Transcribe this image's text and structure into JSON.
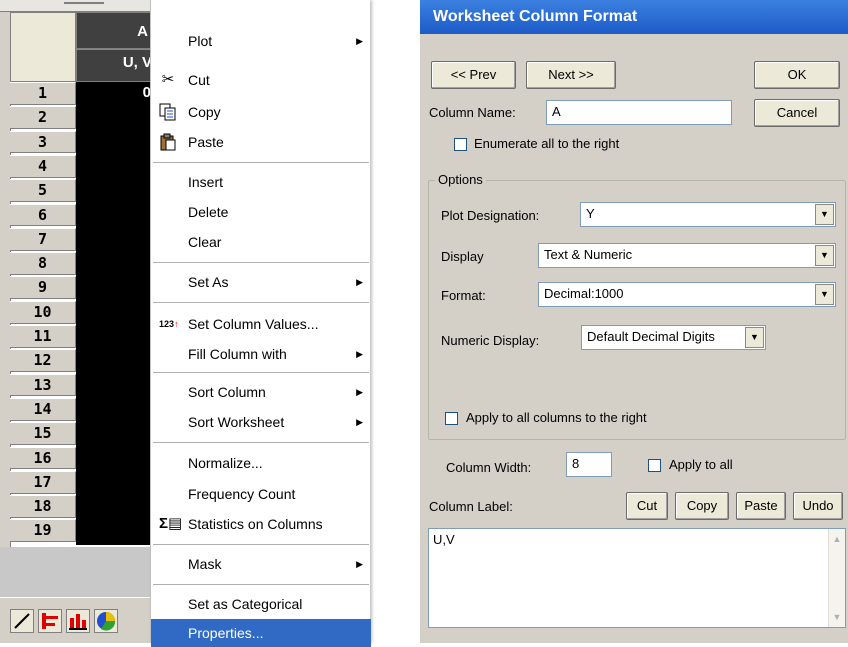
{
  "worksheet": {
    "column_header": "A",
    "column_label": "U, V",
    "row_numbers": [
      "1",
      "2",
      "3",
      "4",
      "5",
      "6",
      "7",
      "8",
      "9",
      "10",
      "11",
      "12",
      "13",
      "14",
      "15",
      "16",
      "17",
      "18",
      "19"
    ],
    "first_cell_value": "0"
  },
  "context_menu": {
    "items": [
      {
        "label": "Plot",
        "submenu": true
      },
      {
        "label": "Cut",
        "icon": "scissors-icon"
      },
      {
        "label": "Copy",
        "icon": "copy-icon"
      },
      {
        "label": "Paste",
        "icon": "paste-icon"
      },
      {
        "label": "Insert"
      },
      {
        "label": "Delete"
      },
      {
        "label": "Clear"
      },
      {
        "label": "Set As",
        "submenu": true
      },
      {
        "label": "Set Column Values...",
        "icon": "set-values-icon"
      },
      {
        "label": "Fill Column with",
        "submenu": true
      },
      {
        "label": "Sort Column",
        "submenu": true
      },
      {
        "label": "Sort Worksheet",
        "submenu": true
      },
      {
        "label": "Normalize..."
      },
      {
        "label": "Frequency Count"
      },
      {
        "label": "Statistics on Columns",
        "icon": "statistics-icon"
      },
      {
        "label": "Mask",
        "submenu": true
      },
      {
        "label": "Set as Categorical"
      },
      {
        "label": "Properties..."
      }
    ],
    "selected_item": "Properties...",
    "highlight_color": "#316ac5"
  },
  "dialog": {
    "title": "Worksheet Column Format",
    "prev_label": "<< Prev",
    "next_label": "Next >>",
    "ok_label": "OK",
    "cancel_label": "Cancel",
    "column_name_label": "Column Name:",
    "column_name_value": "A",
    "enumerate_label": "Enumerate all to the right",
    "options_group": "Options",
    "plot_designation_label": "Plot Designation:",
    "plot_designation_value": "Y",
    "display_label": "Display",
    "display_value": "Text & Numeric",
    "format_label": "Format:",
    "format_value": "Decimal:1000",
    "numeric_display_label": "Numeric Display:",
    "numeric_display_value": "Default Decimal Digits",
    "apply_all_right_label": "Apply to all columns to the right",
    "column_width_label": "Column Width:",
    "column_width_value": "8",
    "apply_to_all_label": "Apply to all",
    "column_label_label": "Column Label:",
    "cut_label": "Cut",
    "copy_label": "Copy",
    "paste_label": "Paste",
    "undo_label": "Undo",
    "column_label_text": "U,V",
    "titlebar_color": "#1d5bc8"
  }
}
